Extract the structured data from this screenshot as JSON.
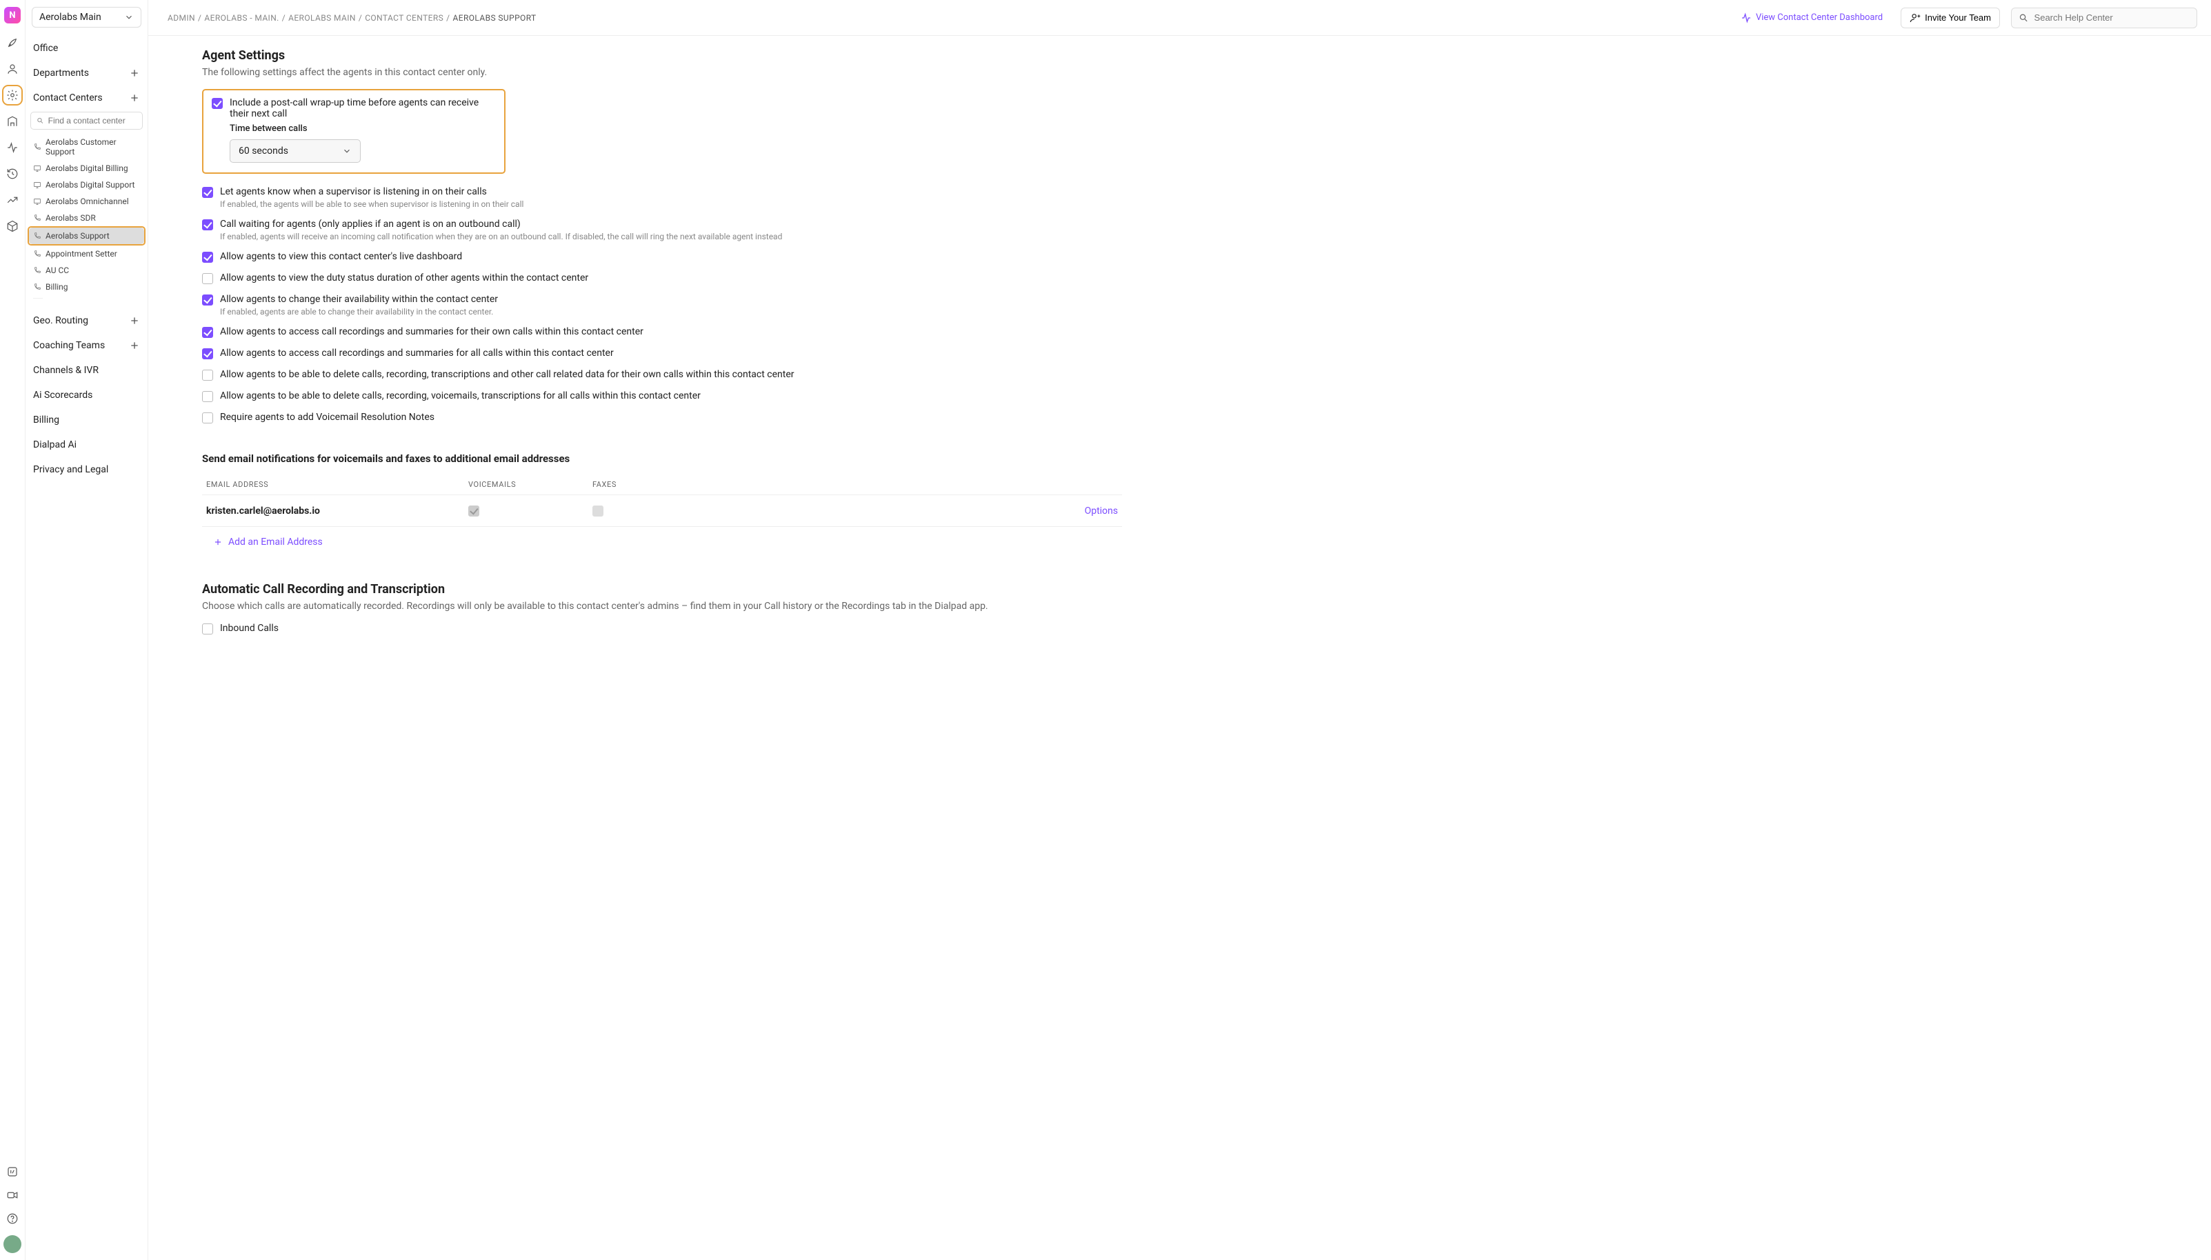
{
  "workspace": {
    "name": "Aerolabs Main"
  },
  "topbar": {
    "breadcrumb": [
      "ADMIN",
      "AEROLABS - MAIN.",
      "AEROLABS MAIN",
      "CONTACT CENTERS",
      "AEROLABS SUPPORT"
    ],
    "dashboard_link": "View Contact Center Dashboard",
    "invite_label": "Invite Your Team",
    "search_placeholder": "Search Help Center"
  },
  "sidebar": {
    "items": {
      "office": "Office",
      "departments": "Departments",
      "contact_centers": "Contact Centers",
      "geo_routing": "Geo. Routing",
      "coaching_teams": "Coaching Teams",
      "channels_ivr": "Channels & IVR",
      "ai_scorecards": "Ai Scorecards",
      "billing": "Billing",
      "dialpad_ai": "Dialpad Ai",
      "privacy_legal": "Privacy and Legal"
    },
    "cc_search_placeholder": "Find a contact center",
    "cc_list": [
      {
        "label": "Aerolabs Customer Support",
        "icon": "phone"
      },
      {
        "label": "Aerolabs Digital Billing",
        "icon": "monitor"
      },
      {
        "label": "Aerolabs Digital Support",
        "icon": "monitor"
      },
      {
        "label": "Aerolabs Omnichannel",
        "icon": "monitor"
      },
      {
        "label": "Aerolabs SDR",
        "icon": "phone"
      },
      {
        "label": "Aerolabs Support",
        "icon": "phone",
        "active": true,
        "highlighted": true
      },
      {
        "label": "Appointment Setter",
        "icon": "phone"
      },
      {
        "label": "AU CC",
        "icon": "phone"
      },
      {
        "label": "Billing",
        "icon": "phone"
      }
    ]
  },
  "agent_settings": {
    "title": "Agent Settings",
    "subtitle": "The following settings affect the agents in this contact center only.",
    "wrapup": {
      "label": "Include a post-call wrap-up time before agents can receive their next call",
      "sublabel": "Time between calls",
      "value": "60 seconds",
      "checked": true
    },
    "rows": [
      {
        "checked": true,
        "label": "Let agents know when a supervisor is listening in on their calls",
        "hint": "If enabled, the agents will be able to see when supervisor is listening in on their call"
      },
      {
        "checked": true,
        "label": "Call waiting for agents (only applies if an agent is on an outbound call)",
        "hint": "If enabled, agents will receive an incoming call notification when they are on an outbound call. If disabled, the call will ring the next available agent instead"
      },
      {
        "checked": true,
        "label": "Allow agents to view this contact center's live dashboard"
      },
      {
        "checked": false,
        "label": "Allow agents to view the duty status duration of other agents within the contact center"
      },
      {
        "checked": true,
        "label": "Allow agents to change their availability within the contact center",
        "hint": "If enabled, agents are able to change their availability in the contact center."
      },
      {
        "checked": true,
        "label": "Allow agents to access call recordings and summaries for their own calls within this contact center"
      },
      {
        "checked": true,
        "label": "Allow agents to access call recordings and summaries for all calls within this contact center"
      },
      {
        "checked": false,
        "label": "Allow agents to be able to delete calls, recording, transcriptions and other call related data for their own calls within this contact center"
      },
      {
        "checked": false,
        "label": "Allow agents to be able to delete calls, recording, voicemails, transcriptions for all calls within this contact center"
      },
      {
        "checked": false,
        "label": "Require agents to add Voicemail Resolution Notes"
      }
    ]
  },
  "email_notify": {
    "title": "Send email notifications for voicemails and faxes to additional email addresses",
    "columns": {
      "email": "EMAIL ADDRESS",
      "voicemails": "VOICEMAILS",
      "faxes": "FAXES"
    },
    "rows": [
      {
        "email": "kristen.carlel@aerolabs.io",
        "voicemails": true,
        "faxes": false,
        "options": "Options"
      }
    ],
    "add_label": "Add an Email Address"
  },
  "recording": {
    "title": "Automatic Call Recording and Transcription",
    "subtitle": "Choose which calls are automatically recorded. Recordings will only be available to this contact center's admins – find them in your Call history or the Recordings tab in the Dialpad app.",
    "inbound": {
      "checked": false,
      "label": "Inbound Calls"
    }
  }
}
